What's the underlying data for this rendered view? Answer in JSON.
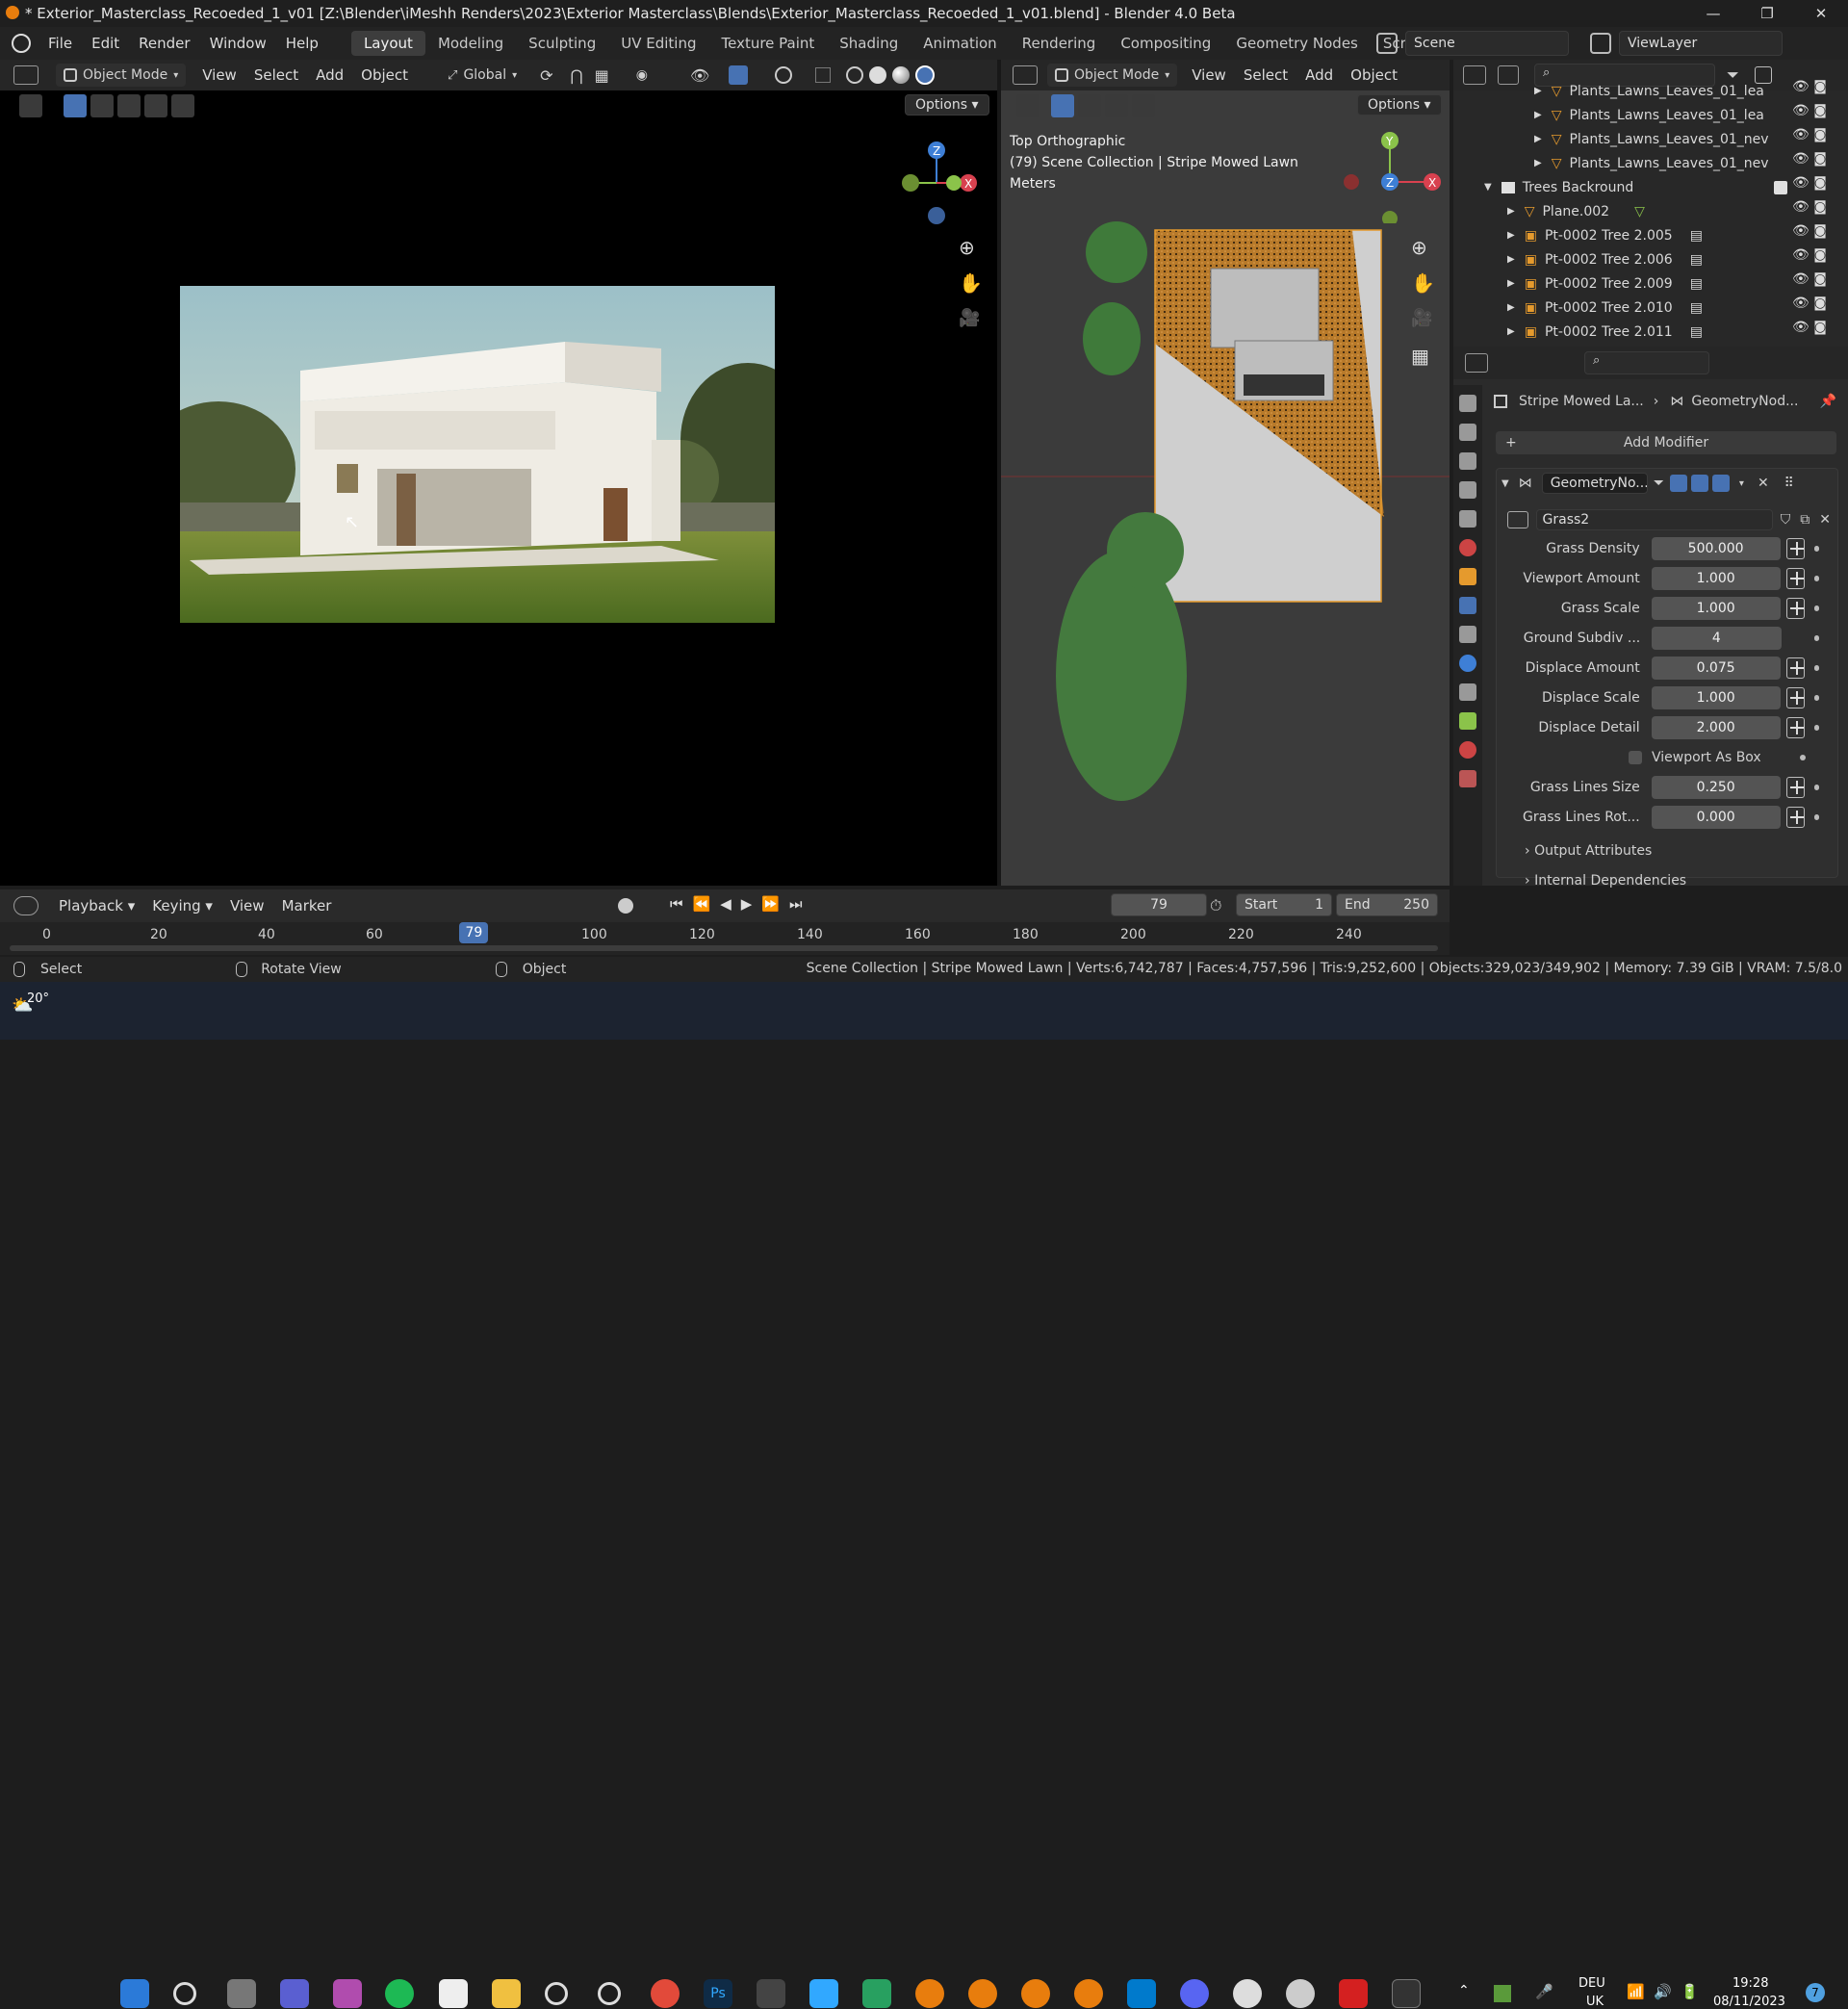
{
  "window": {
    "title": "* Exterior_Masterclass_Recoeded_1_v01 [Z:\\Blender\\iMeshh Renders\\2023\\Exterior Masterclass\\Blends\\Exterior_Masterclass_Recoeded_1_v01.blend] - Blender 4.0 Beta",
    "minimize": "—",
    "maximize": "❐",
    "close": "✕"
  },
  "menubar": {
    "items": [
      "File",
      "Edit",
      "Render",
      "Window",
      "Help"
    ],
    "workspaces": [
      "Layout",
      "Modeling",
      "Sculpting",
      "UV Editing",
      "Texture Paint",
      "Shading",
      "Animation",
      "Rendering",
      "Compositing",
      "Geometry Nodes",
      "Scripting"
    ],
    "add_tab": "+",
    "scene_label": "Scene",
    "viewlayer_label": "ViewLayer"
  },
  "viewport_left": {
    "mode": "Object Mode",
    "menus": [
      "View",
      "Select",
      "Add",
      "Object"
    ],
    "orientation": "Global",
    "options": "Options"
  },
  "viewport_right": {
    "mode": "Object Mode",
    "menus": [
      "View",
      "Select",
      "Add",
      "Object"
    ],
    "options": "Options",
    "overlay_line1": "Top Orthographic",
    "overlay_line2": "(79) Scene Collection | Stripe Mowed Lawn",
    "overlay_line3": "Meters"
  },
  "outliner": {
    "rows": [
      {
        "label": "Plants_Lawns_Leaves_01_lea"
      },
      {
        "label": "Plants_Lawns_Leaves_01_lea"
      },
      {
        "label": "Plants_Lawns_Leaves_01_nev"
      },
      {
        "label": "Plants_Lawns_Leaves_01_nev"
      },
      {
        "label": "Trees Backround"
      },
      {
        "label": "Plane.002"
      },
      {
        "label": "Pt-0002 Tree 2.005"
      },
      {
        "label": "Pt-0002 Tree 2.006"
      },
      {
        "label": "Pt-0002 Tree 2.009"
      },
      {
        "label": "Pt-0002 Tree 2.010"
      },
      {
        "label": "Pt-0002 Tree 2.011"
      }
    ]
  },
  "properties": {
    "breadcrumb_object": "Stripe Mowed La...",
    "breadcrumb_modifier": "GeometryNod...",
    "add_modifier": "Add Modifier",
    "modifier_name": "GeometryNo...",
    "node_group": "Grass2",
    "fields": [
      {
        "label": "Grass Density",
        "value": "500.000"
      },
      {
        "label": "Viewport Amount",
        "value": "1.000"
      },
      {
        "label": "Grass Scale",
        "value": "1.000"
      },
      {
        "label": "Ground Subdiv ...",
        "value": "4"
      },
      {
        "label": "Displace Amount",
        "value": "0.075"
      },
      {
        "label": "Displace Scale",
        "value": "1.000"
      },
      {
        "label": "Displace Detail",
        "value": "2.000"
      }
    ],
    "viewport_as_box": "Viewport As Box",
    "fields2": [
      {
        "label": "Grass Lines Size",
        "value": "0.250"
      },
      {
        "label": "Grass Lines Rot...",
        "value": "0.000"
      }
    ],
    "output_attributes": "Output Attributes",
    "internal_dependencies": "Internal Dependencies"
  },
  "timeline": {
    "menus": [
      "Playback",
      "Keying",
      "View",
      "Marker"
    ],
    "current_frame": "79",
    "start_label": "Start",
    "start_value": "1",
    "end_label": "End",
    "end_value": "250",
    "ticks": [
      "0",
      "20",
      "40",
      "60",
      "100",
      "120",
      "140",
      "160",
      "180",
      "200",
      "220",
      "240"
    ],
    "playhead": "79",
    "playhead_fraction": 0.316
  },
  "statusbar": {
    "select": "Select",
    "rotate": "Rotate View",
    "object": "Object",
    "stats": "Scene Collection | Stripe Mowed Lawn | Verts:6,742,787 | Faces:4,757,596 | Tris:9,252,600 | Objects:329,023/349,902 | Memory: 7.39 GiB | VRAM: 7.5/8.0"
  },
  "taskbar": {
    "weather": "20°",
    "lang1": "DEU",
    "lang2": "UK",
    "time": "19:28",
    "date": "08/11/2023",
    "notif": "7"
  },
  "colors": {
    "accent": "#4772b3",
    "frame_highlight": "#4b71c4",
    "axis_x": "#d8414f",
    "axis_y": "#8bc34a",
    "axis_z": "#3e7fd6"
  }
}
